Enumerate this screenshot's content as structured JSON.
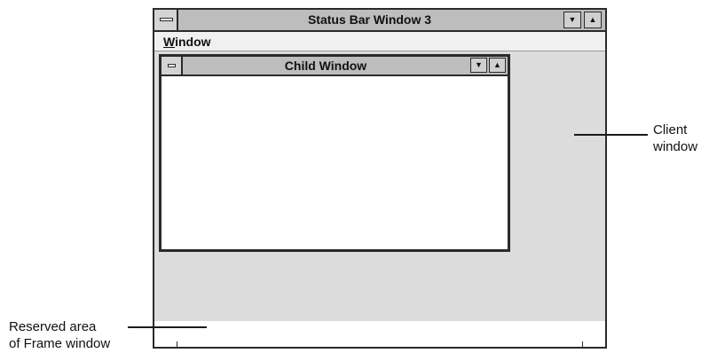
{
  "frame_window": {
    "title": "Status Bar Window 3",
    "menu": {
      "label_rest": "indow",
      "label_accel": "W"
    }
  },
  "child_window": {
    "title": "Child Window"
  },
  "icons": {
    "system_menu": "system-menu-icon",
    "minimize": "down-triangle",
    "maximize": "up-triangle"
  },
  "callouts": {
    "client_line1": "Client",
    "client_line2": "window",
    "reserved_line1": "Reserved area",
    "reserved_line2": "of Frame window"
  },
  "glyphs": {
    "down": "▼",
    "up": "▲"
  }
}
